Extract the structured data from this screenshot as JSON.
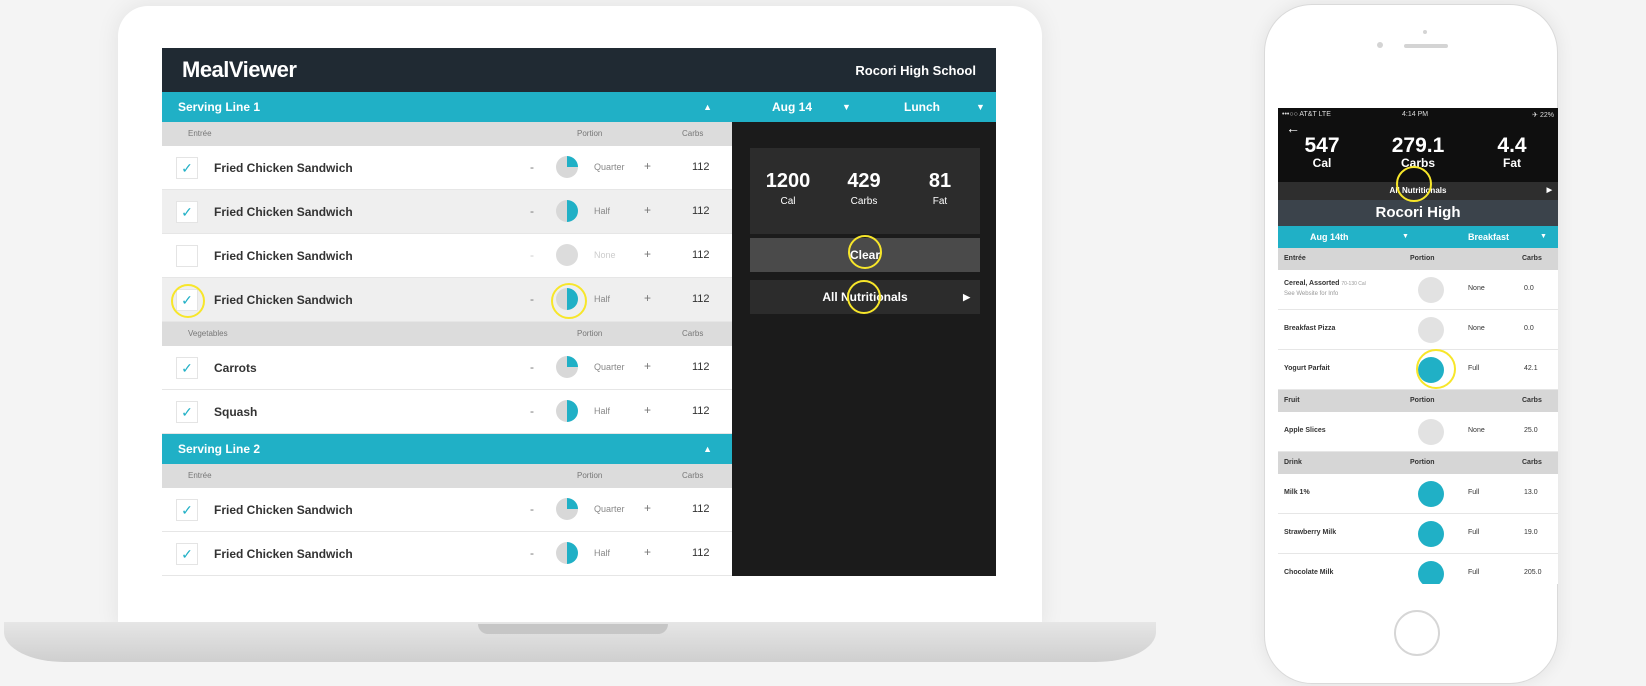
{
  "colors": {
    "accent": "#20b0c6",
    "header_dark": "#202a33",
    "panel_dark": "#1b1b1b",
    "highlight": "#f7e62a"
  },
  "desktop": {
    "app_name": "MealViewer",
    "school": "Rocori High School",
    "date": "Aug 14",
    "meal": "Lunch",
    "totals": [
      {
        "value": "1200",
        "label": "Cal"
      },
      {
        "value": "429",
        "label": "Carbs"
      },
      {
        "value": "81",
        "label": "Fat"
      }
    ],
    "clear_label": "Clear",
    "all_nutritionals_label": "All Nutritionals",
    "serving_lines": [
      {
        "title": "Serving Line 1",
        "groups": [
          {
            "header": {
              "category": "Entrée",
              "portion": "Portion",
              "carbs": "Carbs"
            },
            "items": [
              {
                "name": "Fried Chicken Sandwich",
                "checked": true,
                "portion": "quarter",
                "portion_label": "Quarter",
                "carbs": "112"
              },
              {
                "name": "Fried Chicken Sandwich",
                "checked": true,
                "portion": "half",
                "portion_label": "Half",
                "carbs": "112"
              },
              {
                "name": "Fried Chicken Sandwich",
                "checked": false,
                "portion": "none",
                "portion_label": "None",
                "carbs": "112"
              },
              {
                "name": "Fried Chicken Sandwich",
                "checked": true,
                "portion": "half",
                "portion_label": "Half",
                "carbs": "112"
              }
            ]
          },
          {
            "header": {
              "category": "Vegetables",
              "portion": "Portion",
              "carbs": "Carbs"
            },
            "items": [
              {
                "name": "Carrots",
                "checked": true,
                "portion": "quarter",
                "portion_label": "Quarter",
                "carbs": "112"
              },
              {
                "name": "Squash",
                "checked": true,
                "portion": "half",
                "portion_label": "Half",
                "carbs": "112"
              }
            ]
          }
        ]
      },
      {
        "title": "Serving Line 2",
        "groups": [
          {
            "header": {
              "category": "Entrée",
              "portion": "Portion",
              "carbs": "Carbs"
            },
            "items": [
              {
                "name": "Fried Chicken Sandwich",
                "checked": true,
                "portion": "quarter",
                "portion_label": "Quarter",
                "carbs": "112"
              },
              {
                "name": "Fried Chicken Sandwich",
                "checked": true,
                "portion": "half",
                "portion_label": "Half",
                "carbs": "112"
              }
            ]
          }
        ]
      }
    ]
  },
  "mobile": {
    "status": {
      "carrier": "•••○○ AT&T  LTE",
      "time": "4:14 PM",
      "battery": "✈ 22%"
    },
    "totals": [
      {
        "value": "547",
        "label": "Cal"
      },
      {
        "value": "279.1",
        "label": "Carbs"
      },
      {
        "value": "4.4",
        "label": "Fat"
      }
    ],
    "all_nutritionals_label": "All Nutritionals",
    "school": "Rocori High",
    "date": "Aug 14th",
    "meal": "Breakfast",
    "sections": [
      {
        "header": {
          "category": "Entrée",
          "portion": "Portion",
          "carbs": "Carbs"
        },
        "items": [
          {
            "name": "Cereal, Assorted",
            "extra": "70-130 Cal",
            "note": "See Website for Info",
            "portion": "none",
            "portion_label": "None",
            "carbs": "0.0"
          },
          {
            "name": "Breakfast Pizza",
            "portion": "none",
            "portion_label": "None",
            "carbs": "0.0"
          },
          {
            "name": "Yogurt Parfait",
            "portion": "full",
            "portion_label": "Full",
            "carbs": "42.1"
          }
        ]
      },
      {
        "header": {
          "category": "Fruit",
          "portion": "Portion",
          "carbs": "Carbs"
        },
        "items": [
          {
            "name": "Apple Slices",
            "portion": "none",
            "portion_label": "None",
            "carbs": "25.0"
          }
        ]
      },
      {
        "header": {
          "category": "Drink",
          "portion": "Portion",
          "carbs": "Carbs"
        },
        "items": [
          {
            "name": "Milk 1%",
            "portion": "full",
            "portion_label": "Full",
            "carbs": "13.0"
          },
          {
            "name": "Strawberry Milk",
            "portion": "full",
            "portion_label": "Full",
            "carbs": "19.0"
          },
          {
            "name": "Chocolate Milk",
            "portion": "full",
            "portion_label": "Full",
            "carbs": "205.0"
          }
        ]
      }
    ]
  }
}
